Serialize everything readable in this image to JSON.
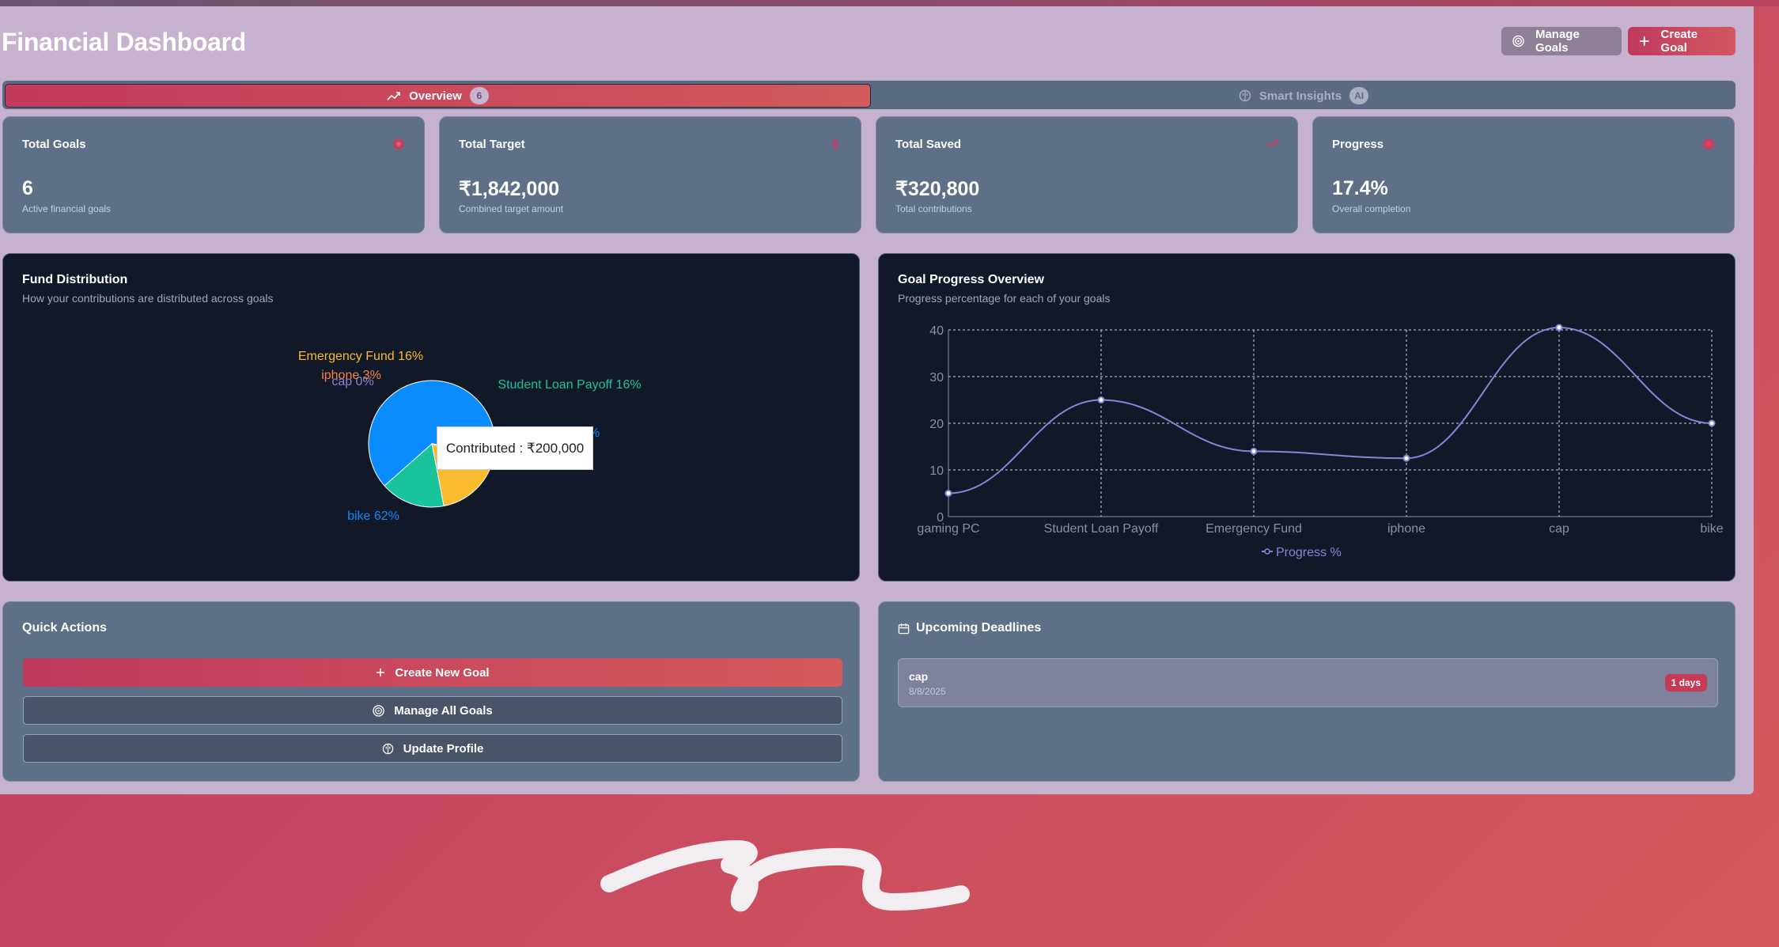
{
  "header": {
    "title": "Financial Dashboard",
    "manage_goals_label": "Manage Goals",
    "create_goal_label": "Create Goal"
  },
  "tabs": [
    {
      "label": "Overview",
      "badge": "6",
      "icon": "trending-up-icon",
      "active": true
    },
    {
      "label": "Smart Insights",
      "badge": "AI",
      "icon": "brain-icon",
      "active": false
    }
  ],
  "stats": [
    {
      "label": "Total Goals",
      "value": "6",
      "sub": "Active financial goals",
      "icon": "target-icon"
    },
    {
      "label": "Total Target",
      "value": "₹1,842,000",
      "sub": "Combined target amount",
      "icon": "dollar-icon"
    },
    {
      "label": "Total Saved",
      "value": "₹320,800",
      "sub": "Total contributions",
      "icon": "trending-up-icon"
    },
    {
      "label": "Progress",
      "value": "17.4%",
      "sub": "Overall completion",
      "icon": "award-icon"
    }
  ],
  "fund_distribution": {
    "title": "Fund Distribution",
    "subtitle": "How your contributions are distributed across goals",
    "tooltip": "Contributed : ₹200,000"
  },
  "goal_progress": {
    "title": "Goal Progress Overview",
    "subtitle": "Progress percentage for each of your goals"
  },
  "chart_data": [
    {
      "type": "pie",
      "title": "Fund Distribution",
      "slices": [
        {
          "label": "bike 62%",
          "name": "bike",
          "percent": 62,
          "color": "#0a8cff"
        },
        {
          "label": "Emergency Fund 16%",
          "name": "Emergency Fund",
          "percent": 16,
          "color": "#fbbb2e"
        },
        {
          "label": "Student Loan Payoff 16%",
          "name": "Student Loan Payoff",
          "percent": 16,
          "color": "#19c49a"
        },
        {
          "label": "iphone 3%",
          "name": "iphone",
          "percent": 3,
          "color": "#fd8042"
        },
        {
          "label": "cap 0%",
          "name": "cap",
          "percent": 0,
          "color": "#8884d8"
        },
        {
          "label": "gaming PC",
          "name": "gaming PC",
          "percent": 3,
          "color": "#0a8cff"
        }
      ],
      "hidden_label_fragment": "%"
    },
    {
      "type": "line",
      "title": "Goal Progress Overview",
      "categories": [
        "gaming PC",
        "Student Loan Payoff",
        "Emergency Fund",
        "iphone",
        "cap",
        "bike"
      ],
      "series": [
        {
          "name": "Progress %",
          "values": [
            5,
            25,
            14,
            12.5,
            40.5,
            20
          ],
          "color": "#8884d8"
        }
      ],
      "yticks": [
        "0",
        "10",
        "20",
        "30",
        "40"
      ],
      "ylim": [
        0,
        40
      ],
      "grid": true,
      "legend": "bottom"
    }
  ],
  "quick_actions": {
    "title": "Quick Actions",
    "create_label": "Create New Goal",
    "manage_label": "Manage All Goals",
    "profile_label": "Update Profile"
  },
  "deadlines": {
    "title": "Upcoming Deadlines",
    "items": [
      {
        "name": "cap",
        "date": "8/8/2025",
        "badge": "1 days"
      }
    ]
  },
  "colors": {
    "accent": "#c83c5c",
    "card": "#5e7088",
    "dark_card": "#111827"
  }
}
